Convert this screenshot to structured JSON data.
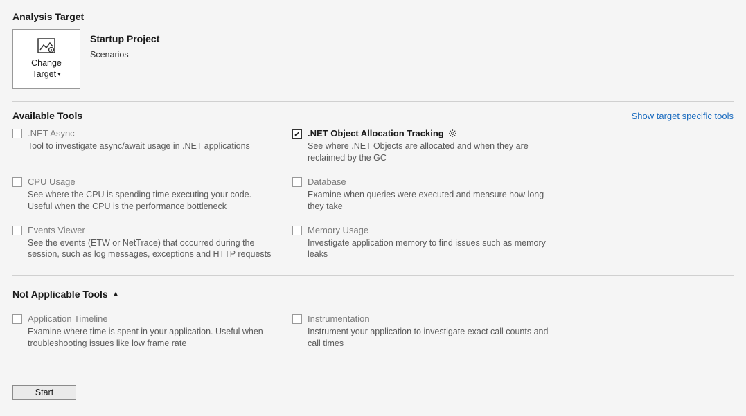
{
  "target_section": {
    "heading": "Analysis Target",
    "change_target_label_line1": "Change",
    "change_target_label_line2": "Target",
    "project_title": "Startup Project",
    "project_subtitle": "Scenarios"
  },
  "available": {
    "heading": "Available Tools",
    "show_specific_link": "Show target specific tools",
    "tools": [
      {
        "id": "net-async",
        "title": ".NET Async",
        "desc": "Tool to investigate async/await usage in .NET applications",
        "checked": false,
        "bold": false,
        "enabled": false,
        "gear": false
      },
      {
        "id": "net-obj-alloc",
        "title": ".NET Object Allocation Tracking",
        "desc": "See where .NET Objects are allocated and when they are reclaimed by the GC",
        "checked": true,
        "bold": true,
        "enabled": true,
        "gear": true
      },
      {
        "id": "cpu-usage",
        "title": "CPU Usage",
        "desc": "See where the CPU is spending time executing your code. Useful when the CPU is the performance bottleneck",
        "checked": false,
        "bold": false,
        "enabled": false,
        "gear": false
      },
      {
        "id": "database",
        "title": "Database",
        "desc": "Examine when queries were executed and measure how long they take",
        "checked": false,
        "bold": false,
        "enabled": false,
        "gear": false
      },
      {
        "id": "events-viewer",
        "title": "Events Viewer",
        "desc": "See the events (ETW or NetTrace) that occurred during the session, such as log messages, exceptions and HTTP requests",
        "checked": false,
        "bold": false,
        "enabled": false,
        "gear": false
      },
      {
        "id": "memory-usage",
        "title": "Memory Usage",
        "desc": "Investigate application memory to find issues such as memory leaks",
        "checked": false,
        "bold": false,
        "enabled": false,
        "gear": false
      }
    ]
  },
  "not_applicable": {
    "heading": "Not Applicable Tools",
    "tools": [
      {
        "id": "app-timeline",
        "title": "Application Timeline",
        "desc": "Examine where time is spent in your application. Useful when troubleshooting issues like low frame rate",
        "checked": false,
        "enabled": false
      },
      {
        "id": "instrumentation",
        "title": "Instrumentation",
        "desc": "Instrument your application to investigate exact call counts and call times",
        "checked": false,
        "enabled": false
      }
    ]
  },
  "footer": {
    "start_label": "Start"
  }
}
